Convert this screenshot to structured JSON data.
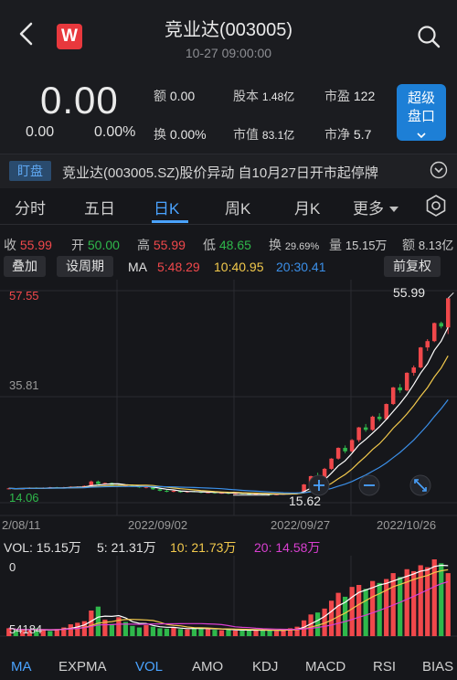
{
  "header": {
    "title": "竞业达(003005)",
    "subtitle": "10-27 09:00:00",
    "logo": "W"
  },
  "quote": {
    "price": "0.00",
    "change": "0.00",
    "change_pct": "0.00%",
    "stats": [
      {
        "label": "额",
        "value": "0.00"
      },
      {
        "label": "股本",
        "value": "1.48亿"
      },
      {
        "label": "市盈",
        "value": "122"
      },
      {
        "label": "换",
        "value": "0.00%"
      },
      {
        "label": "市值",
        "value": "83.1亿"
      },
      {
        "label": "市净",
        "value": "5.7"
      }
    ],
    "super_button": [
      "超级",
      "盘口"
    ]
  },
  "news": {
    "tag": "盯盘",
    "text": "竞业达(003005.SZ)股价异动 自10月27日开市起停牌"
  },
  "tabs": [
    "分时",
    "五日",
    "日K",
    "周K",
    "月K",
    "更多"
  ],
  "active_tab": "日K",
  "ohlc": [
    {
      "label": "收",
      "value": "55.99",
      "color": "#f0484b"
    },
    {
      "label": "开",
      "value": "50.00",
      "color": "#2fb84b"
    },
    {
      "label": "高",
      "value": "55.99",
      "color": "#f0484b"
    },
    {
      "label": "低",
      "value": "48.65",
      "color": "#2fb84b"
    },
    {
      "label": "换",
      "value": "29.69%",
      "color": "#d0d0d0"
    },
    {
      "label": "量",
      "value": "15.15万",
      "color": "#d0d0d0"
    },
    {
      "label": "额",
      "value": "8.13亿",
      "color": "#d0d0d0"
    }
  ],
  "toolbar": {
    "overlay": "叠加",
    "period": "设周期",
    "ma_label": "MA",
    "ma5": "5:48.29",
    "ma10": "10:40.95",
    "ma20": "20:30.41",
    "adjust": "前复权"
  },
  "colors": {
    "up": "#f0484b",
    "down": "#2fb84b",
    "ma5": "#ffffff",
    "ma10": "#f2c94c",
    "ma20": "#3b8fe8",
    "vol20": "#d93fd1",
    "accent": "#4aa3ff"
  },
  "chart_data": {
    "type": "candlestick",
    "y_labels": [
      "57.55",
      "35.81",
      "14.06"
    ],
    "x_labels": [
      "2/08/11",
      "2022/09/02",
      "2022/09/27",
      "2022/10/26"
    ],
    "annotations": {
      "high": "55.99",
      "low": "15.62"
    },
    "ylim": [
      14.06,
      57.55
    ],
    "candles": [
      [
        16.9,
        17.1,
        16.8,
        17.0
      ],
      [
        17.0,
        17.0,
        16.8,
        16.9
      ],
      [
        16.9,
        17.0,
        16.8,
        17.0
      ],
      [
        17.0,
        17.2,
        16.9,
        17.1
      ],
      [
        17.1,
        17.2,
        16.9,
        17.0
      ],
      [
        17.0,
        17.2,
        16.9,
        17.1
      ],
      [
        17.1,
        17.3,
        17.0,
        17.2
      ],
      [
        17.2,
        17.3,
        17.0,
        17.1
      ],
      [
        17.1,
        17.3,
        17.0,
        17.2
      ],
      [
        17.2,
        17.4,
        17.1,
        17.3
      ],
      [
        17.3,
        17.4,
        17.2,
        17.3
      ],
      [
        17.3,
        17.6,
        17.2,
        17.5
      ],
      [
        17.5,
        18.6,
        17.4,
        18.4
      ],
      [
        18.4,
        18.6,
        17.8,
        17.9
      ],
      [
        17.9,
        18.2,
        17.7,
        18.1
      ],
      [
        18.1,
        18.2,
        17.6,
        17.7
      ],
      [
        17.7,
        17.9,
        17.4,
        17.5
      ],
      [
        17.5,
        17.7,
        17.3,
        17.6
      ],
      [
        17.6,
        17.8,
        17.3,
        17.4
      ],
      [
        17.4,
        17.5,
        17.1,
        17.2
      ],
      [
        17.2,
        17.4,
        17.0,
        17.3
      ],
      [
        17.3,
        17.4,
        16.7,
        16.8
      ],
      [
        16.8,
        17.0,
        16.4,
        16.5
      ],
      [
        16.5,
        16.7,
        16.2,
        16.3
      ],
      [
        16.3,
        16.6,
        16.2,
        16.5
      ],
      [
        16.5,
        16.6,
        16.1,
        16.2
      ],
      [
        16.2,
        16.5,
        16.1,
        16.4
      ],
      [
        16.4,
        16.5,
        16.2,
        16.3
      ],
      [
        16.3,
        16.4,
        16.0,
        16.1
      ],
      [
        16.1,
        16.3,
        16.0,
        16.2
      ],
      [
        16.2,
        16.3,
        15.9,
        16.0
      ],
      [
        16.0,
        16.2,
        15.9,
        16.1
      ],
      [
        16.1,
        16.2,
        15.8,
        15.9
      ],
      [
        15.9,
        16.1,
        15.8,
        16.0
      ],
      [
        16.0,
        16.1,
        15.8,
        15.9
      ],
      [
        15.9,
        16.0,
        15.7,
        15.8
      ],
      [
        15.8,
        16.0,
        15.7,
        15.9
      ],
      [
        15.9,
        16.0,
        15.7,
        15.8
      ],
      [
        15.8,
        15.9,
        15.6,
        15.7
      ],
      [
        15.7,
        15.9,
        15.62,
        15.8
      ],
      [
        15.8,
        16.0,
        15.7,
        15.9
      ],
      [
        15.9,
        16.1,
        15.8,
        16.0
      ],
      [
        16.0,
        16.2,
        15.9,
        16.1
      ],
      [
        16.1,
        17.9,
        16.0,
        17.8
      ],
      [
        17.8,
        19.6,
        17.7,
        19.5
      ],
      [
        19.5,
        20.2,
        18.9,
        19.2
      ],
      [
        19.2,
        21.2,
        19.0,
        21.0
      ],
      [
        21.0,
        23.2,
        20.8,
        23.1
      ],
      [
        23.1,
        25.4,
        22.9,
        25.3
      ],
      [
        25.3,
        25.8,
        24.2,
        24.6
      ],
      [
        24.6,
        27.1,
        24.4,
        26.9
      ],
      [
        26.9,
        29.6,
        26.5,
        29.5
      ],
      [
        29.5,
        30.2,
        28.6,
        29.0
      ],
      [
        29.0,
        31.9,
        28.8,
        31.7
      ],
      [
        31.7,
        32.4,
        30.8,
        31.2
      ],
      [
        31.2,
        34.4,
        31.0,
        34.3
      ],
      [
        34.3,
        37.8,
        34.1,
        37.7
      ],
      [
        37.7,
        38.4,
        36.6,
        37.1
      ],
      [
        37.1,
        40.8,
        36.9,
        40.7
      ],
      [
        40.7,
        42.2,
        40.1,
        41.8
      ],
      [
        41.8,
        46.0,
        41.6,
        45.9
      ],
      [
        45.9,
        47.6,
        45.2,
        47.2
      ],
      [
        47.2,
        51.0,
        47.0,
        50.9
      ],
      [
        50.9,
        51.2,
        49.8,
        50.2
      ],
      [
        50.0,
        55.99,
        48.65,
        55.99
      ]
    ]
  },
  "volume": {
    "legend_label": "VOL: 15.15万",
    "ma5": "5: 21.31万",
    "ma10": "10: 21.73万",
    "ma20": "20: 14.58万",
    "y_top": "0",
    "y_bottom": "54184",
    "bars": [
      2,
      1.5,
      1.6,
      1.4,
      2,
      1.5,
      1.3,
      1.8,
      2.2,
      3,
      3.4,
      3.8,
      6.5,
      7.5,
      4.2,
      3.1,
      4.8,
      3.6,
      2.6,
      2.2,
      2.8,
      2.4,
      2.0,
      1.9,
      2.1,
      1.8,
      1.7,
      2.2,
      2.0,
      1.8,
      1.6,
      1.5,
      1.7,
      1.4,
      1.6,
      1.5,
      1.4,
      1.6,
      1.5,
      1.3,
      1.6,
      2.0,
      2.4,
      4.0,
      5.5,
      6.0,
      7.0,
      9.0,
      11.0,
      10.0,
      12.5,
      13.0,
      12.0,
      14.0,
      13.5,
      14.5,
      16.0,
      15.0,
      17.0,
      16.5,
      18.0,
      17.5,
      19.5,
      18.5,
      16.0
    ],
    "bar_up": [
      true,
      false,
      true,
      true,
      false,
      true,
      false,
      true,
      true,
      true,
      true,
      true,
      true,
      false,
      true,
      false,
      true,
      false,
      false,
      false,
      true,
      false,
      false,
      false,
      true,
      false,
      true,
      false,
      false,
      true,
      false,
      true,
      false,
      true,
      false,
      false,
      true,
      false,
      false,
      true,
      true,
      true,
      true,
      true,
      true,
      false,
      true,
      true,
      true,
      false,
      true,
      true,
      false,
      true,
      false,
      true,
      true,
      false,
      true,
      true,
      true,
      true,
      true,
      false,
      true
    ]
  },
  "bottom_tabs": [
    "MA",
    "EXPMA",
    "VOL",
    "AMO",
    "KDJ",
    "MACD",
    "RSI",
    "BIAS"
  ],
  "bottom_active": [
    "MA",
    "VOL"
  ]
}
